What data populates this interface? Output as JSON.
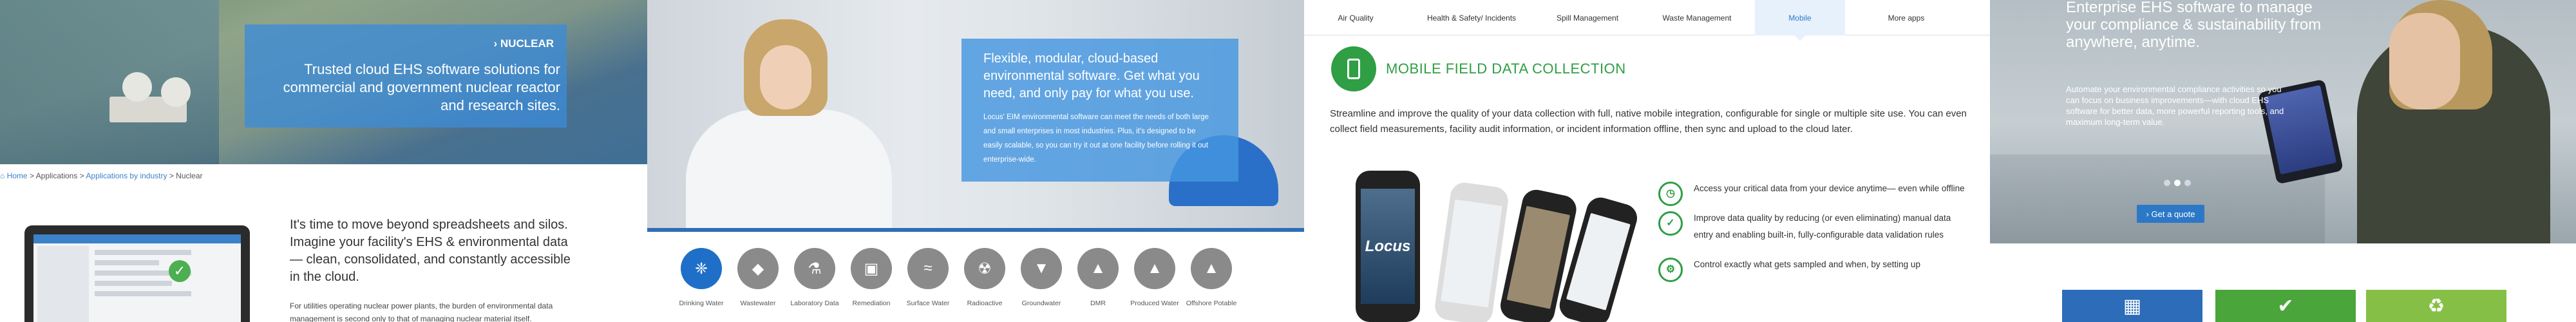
{
  "panel1": {
    "hero_label": "NUCLEAR",
    "hero_tagline": "Trusted cloud EHS software solutions for commercial and government nuclear reactor and research sites.",
    "breadcrumb": {
      "home": "Home",
      "sep": ">",
      "applications": "Applications",
      "by_industry": "Applications by industry",
      "current": "Nuclear"
    },
    "intro": "It's time to move beyond spreadsheets and silos.  Imagine your facility's EHS & environmental data— clean, consolidated, and constantly accessible in the cloud.",
    "body": "For utilities operating nuclear power plants, the burden of environmental data management is second only to that of managing nuclear material itself."
  },
  "panel2": {
    "overlay_head": "Flexible, modular, cloud-based environmental software. Get what you need, and only pay for what you use.",
    "overlay_sub": "Locus' EIM environmental software can meet the needs of both large and small enterprises in most industries. Plus, it's designed to be easily scalable, so you can try it out at one facility before rolling it out enterprise-wide.",
    "industries": [
      {
        "label": "Drinking Water",
        "icon": "water-drop-icon",
        "glyph": "❈"
      },
      {
        "label": "Wastewater",
        "icon": "wastewater-icon",
        "glyph": "◆"
      },
      {
        "label": "Laboratory Data",
        "icon": "flask-icon",
        "glyph": "⚗"
      },
      {
        "label": "Remediation",
        "icon": "truck-icon",
        "glyph": "▣"
      },
      {
        "label": "Surface Water",
        "icon": "surface-water-icon",
        "glyph": "≈"
      },
      {
        "label": "Radioactive",
        "icon": "radioactive-icon",
        "glyph": "☢"
      },
      {
        "label": "Groundwater",
        "icon": "groundwater-icon",
        "glyph": "▼"
      },
      {
        "label": "DMR",
        "icon": "dmr-icon",
        "glyph": "▲"
      },
      {
        "label": "Produced Water",
        "icon": "produced-water-icon",
        "glyph": "▲"
      },
      {
        "label": "Offshore Potable",
        "icon": "offshore-potable-icon",
        "glyph": "▲"
      }
    ]
  },
  "panel3": {
    "tabs": [
      {
        "label": "Air Quality"
      },
      {
        "label": "Health & Safety/ Incidents"
      },
      {
        "label": "Spill Management"
      },
      {
        "label": "Waste Management"
      },
      {
        "label": "Mobile"
      },
      {
        "label": "More apps"
      }
    ],
    "active_tab": "Mobile",
    "title": "MOBILE FIELD DATA COLLECTION",
    "description": "Streamline and improve the quality of your data collection with full, native mobile integration, configurable for single or multiple site use.  You can even collect field measurements, facility audit information, or incident information offline, then sync and upload to the cloud later.",
    "phone_brand": "Locus",
    "features": [
      {
        "text": "Access your critical data from your device anytime— even while offline",
        "icon": "clock-icon",
        "glyph": "◷"
      },
      {
        "text": "Improve data quality by reducing (or even eliminating) manual data entry and enabling built-in, fully-configurable data validation rules",
        "icon": "checkmark-icon",
        "glyph": "✓"
      },
      {
        "text": "Control exactly what gets sampled and when, by setting up",
        "icon": "settings-icon",
        "glyph": "⚙"
      }
    ]
  },
  "panel4": {
    "headline": "Enterprise EHS software to manage your compliance & sustainability from anywhere, anytime.",
    "sub": "Automate your environmental compliance activities so you can focus on business improvements—with cloud EHS software for better data, more powerful reporting tools, and maximum long-term value.",
    "cta": "Get a quote",
    "carousel_dots": 3,
    "active_dot": 2,
    "tiles": [
      {
        "icon": "building-icon",
        "glyph": "▦"
      },
      {
        "icon": "checkmark-icon",
        "glyph": "✔"
      },
      {
        "icon": "recycle-icon",
        "glyph": "♻"
      }
    ]
  },
  "colors": {
    "blue": "#2c78c7",
    "green": "#2f9e44",
    "overlay_blue": "#3c8cd7"
  }
}
